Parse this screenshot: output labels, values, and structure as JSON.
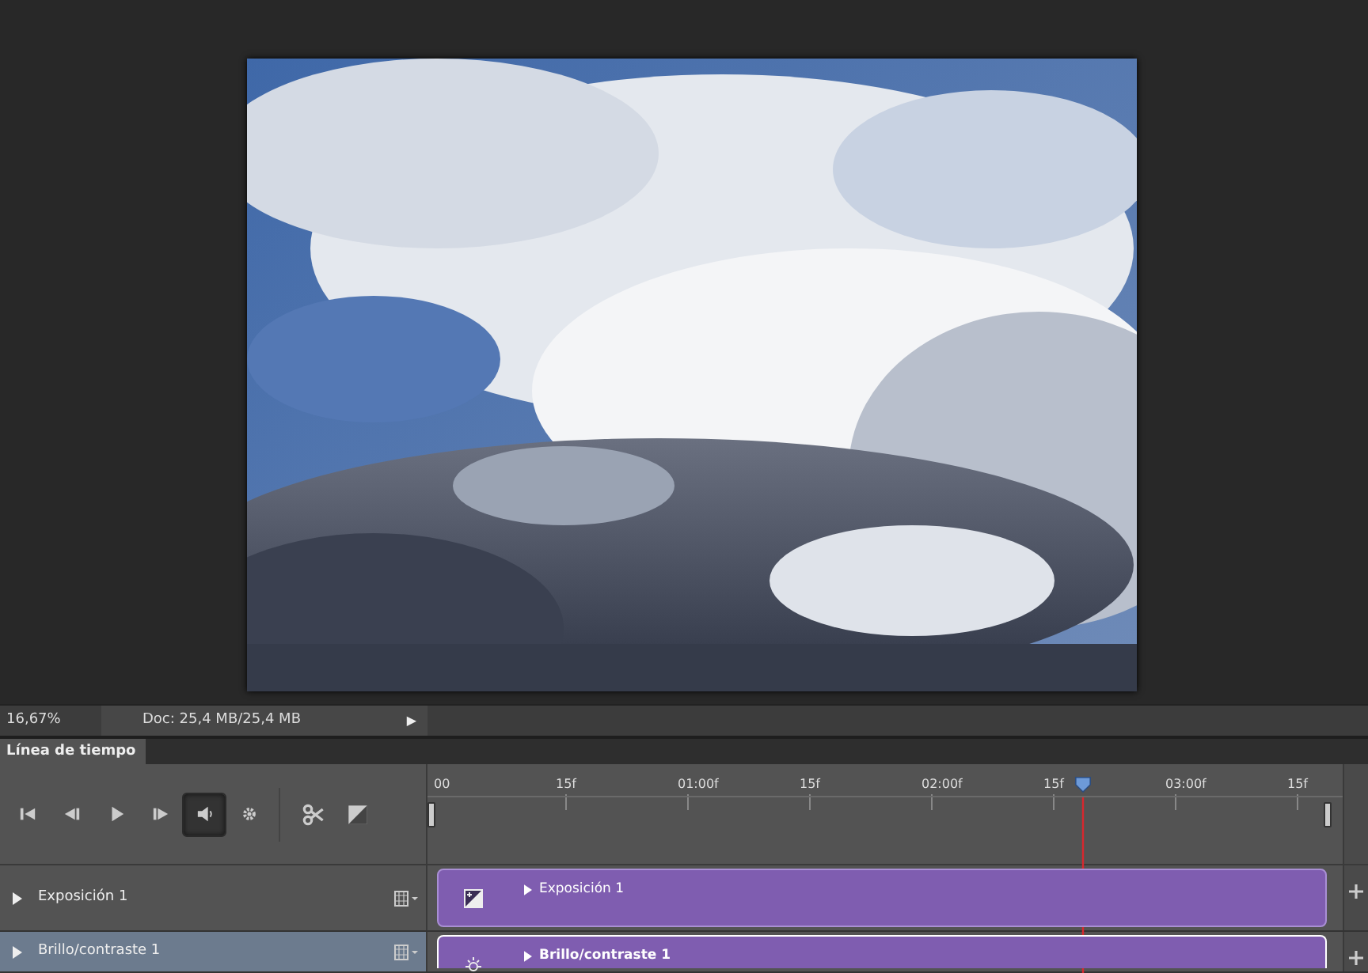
{
  "status_bar": {
    "zoom": "16,67%",
    "doc_info": "Doc: 25,4 MB/25,4 MB",
    "menu_arrow": "▶"
  },
  "panel_tabs": [
    {
      "label": "Línea de tiempo",
      "selected": true
    }
  ],
  "toolbar": [
    {
      "kind": "first",
      "selected": false
    },
    {
      "kind": "prev",
      "selected": false
    },
    {
      "kind": "play",
      "selected": false
    },
    {
      "kind": "next",
      "selected": false
    },
    {
      "kind": "audio",
      "selected": true
    },
    {
      "kind": "settings",
      "selected": false
    },
    {
      "kind": "split",
      "selected": false
    },
    {
      "kind": "transition",
      "selected": false
    }
  ],
  "ruler": {
    "labels": [
      "00",
      "15f",
      "01:00f",
      "15f",
      "02:00f",
      "15f",
      "03:00f",
      "15f"
    ]
  },
  "playhead": {
    "level": 0.717
  },
  "tracks": [
    {
      "name": "Exposición 1",
      "clip": "Exposición 1",
      "kind": "exposure",
      "selected": false
    },
    {
      "name": "Brillo/contraste 1",
      "clip": "Brillo/contraste 1",
      "kind": "brightness",
      "selected": true
    }
  ]
}
